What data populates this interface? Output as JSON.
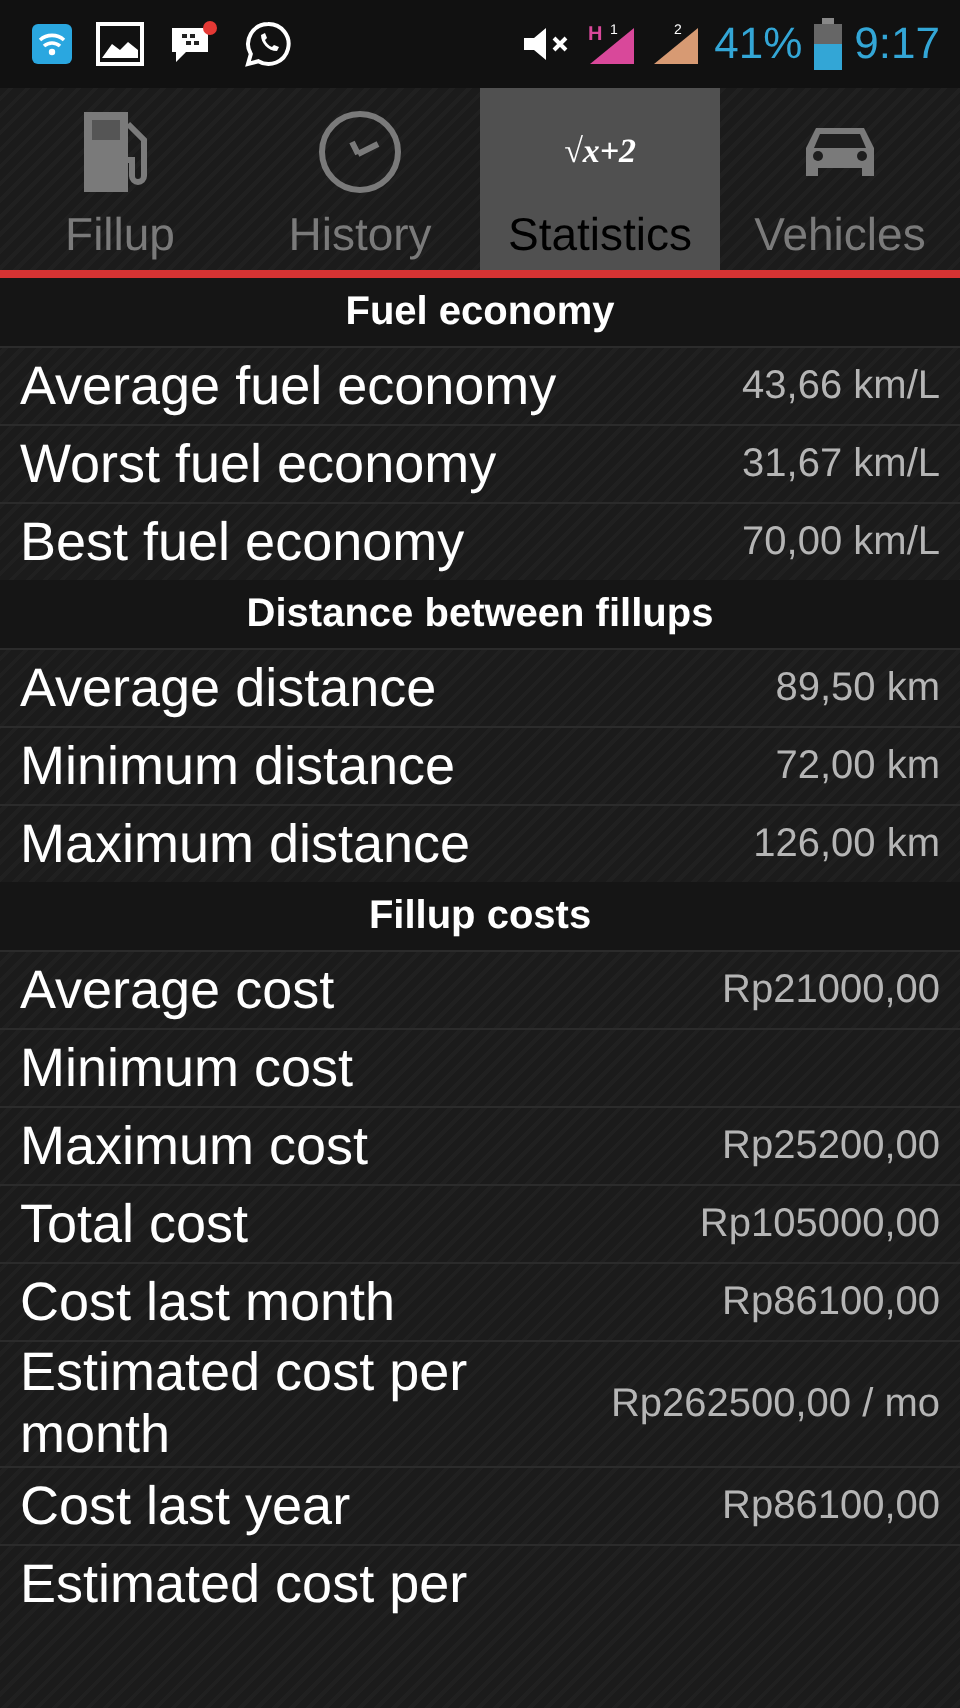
{
  "status_bar": {
    "sim1_network": "H",
    "sim1_label": "1",
    "sim2_label": "2",
    "battery": "41%",
    "time": "9:17"
  },
  "tabs": [
    {
      "label": "Fillup",
      "selected": false
    },
    {
      "label": "History",
      "selected": false
    },
    {
      "label": "Statistics",
      "selected": true,
      "icon_text": "√x+2"
    },
    {
      "label": "Vehicles",
      "selected": false
    }
  ],
  "sections": [
    {
      "title": "Fuel economy",
      "rows": [
        {
          "label": "Average fuel economy",
          "value": "43,66 km/L"
        },
        {
          "label": "Worst fuel economy",
          "value": "31,67 km/L"
        },
        {
          "label": "Best fuel economy",
          "value": "70,00 km/L"
        }
      ]
    },
    {
      "title": "Distance between fillups",
      "rows": [
        {
          "label": "Average distance",
          "value": "89,50 km"
        },
        {
          "label": "Minimum distance",
          "value": "72,00 km"
        },
        {
          "label": "Maximum distance",
          "value": "126,00 km"
        }
      ]
    },
    {
      "title": "Fillup costs",
      "rows": [
        {
          "label": "Average cost",
          "value": "Rp21000,00"
        },
        {
          "label": "Minimum cost"
        },
        {
          "label": "Maximum cost",
          "value": "Rp25200,00"
        },
        {
          "label": "Total cost",
          "value": "Rp105000,00"
        },
        {
          "label": "Cost last month",
          "value": "Rp86100,00"
        },
        {
          "label": "Estimated cost per month",
          "value": "Rp262500,00 / mo"
        },
        {
          "label": "Cost last year",
          "value": "Rp86100,00"
        },
        {
          "label": "Estimated cost per"
        }
      ]
    }
  ]
}
